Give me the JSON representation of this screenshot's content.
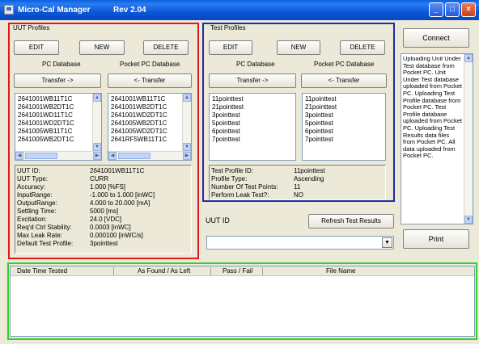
{
  "window": {
    "app_title": "Micro-Cal Manager",
    "revision": "Rev 2.04",
    "minimize": "_",
    "maximize": "□",
    "close": "×"
  },
  "uut_profiles": {
    "title": "UUT Profiles",
    "edit": "EDIT",
    "new": "NEW",
    "delete": "DELETE",
    "pc_db_label": "PC Database",
    "ppc_db_label": "Pocket PC Database",
    "transfer_to": "Transfer ->",
    "transfer_from": "<- Transfer",
    "pc_items": [
      "2641001WB11T1C",
      "2641001WB2DT1C",
      "2641001WD11T1C",
      "2641001WD2DT1C",
      "2641005WB11T1C",
      "2641005WB2DT1C"
    ],
    "ppc_items": [
      "2641001WB11T1C",
      "2641001WB2DT1C",
      "2641001WD2DT1C",
      "2641005WB2DT1C",
      "2641005WD2DT1C",
      "2641RF5WB11T1C"
    ],
    "details": [
      {
        "k": "UUT ID:",
        "v": "2641001WB11T1C"
      },
      {
        "k": "UUT Type:",
        "v": "CURR"
      },
      {
        "k": "Accuracy:",
        "v": "1.000 [%FS]"
      },
      {
        "k": "InputRange:",
        "v": "-1.000 to 1.000 [inWC]"
      },
      {
        "k": "OutputRange:",
        "v": "4.000 to 20.000 [mA]"
      },
      {
        "k": "Settling Time:",
        "v": "5000 [ms]"
      },
      {
        "k": "Excitation:",
        "v": "24.0 [VDC]"
      },
      {
        "k": "Req'd Ctrl Stability:",
        "v": "0.0003 [inWC]"
      },
      {
        "k": "Max Leak Rate:",
        "v": "0.000100 [inWC/s]"
      },
      {
        "k": "Default Test Profile:",
        "v": "3pointtest"
      }
    ]
  },
  "test_profiles": {
    "title": "Test Profiles",
    "edit": "EDIT",
    "new": "NEW",
    "delete": "DELETE",
    "pc_db_label": "PC Database",
    "ppc_db_label": "Pocket PC Database",
    "transfer_to": "Transfer ->",
    "transfer_from": "<- Transfer",
    "pc_items": [
      "11pointtest",
      "21pointtest",
      "3pointtest",
      "5pointtest",
      "6pointtest",
      "7pointtest"
    ],
    "ppc_items": [
      "11pointtest",
      "21pointtest",
      "3pointtest",
      "5pointtest",
      "6pointtest",
      "7pointtest"
    ],
    "details": [
      {
        "k": "Test Profile ID:",
        "v": "11pointtest"
      },
      {
        "k": "Profile Type:",
        "v": "Ascending"
      },
      {
        "k": "Number Of Test Points:",
        "v": "11"
      },
      {
        "k": "Perform Leak Test?:",
        "v": "NO"
      }
    ]
  },
  "uut_id": {
    "label": "UUT ID",
    "refresh": "Refresh Test Results",
    "value": ""
  },
  "connect": "Connect",
  "print": "Print",
  "log": "Uploading Unit Under Test database from Pocket PC. Unit Under Test database uploaded from Pocket PC. Uploading Test Profile database from Pocket PC. Test Profile database uploaded from Pocket PC. Uploading Test Results data files from Pocket PC. All data uploaded from Pocket PC.",
  "results": {
    "columns": [
      "Date Time Tested",
      "As Found / As Left",
      "Pass / Fail",
      "File Name"
    ]
  },
  "colors": {
    "highlight_uut": "#e31818",
    "highlight_test": "#1a2ea8",
    "highlight_results": "#2ed12e"
  }
}
